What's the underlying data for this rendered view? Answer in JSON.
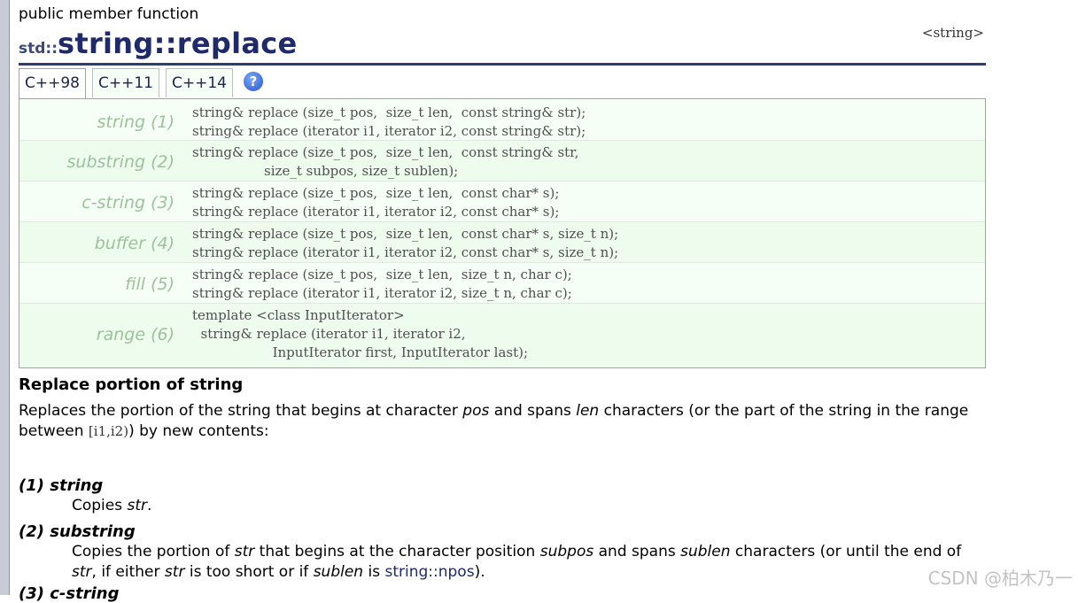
{
  "header": {
    "kind": "public member function",
    "ns": "std::",
    "name": "string::replace",
    "ref": "<string>"
  },
  "tabs": [
    {
      "label": "C++98"
    },
    {
      "label": "C++11"
    },
    {
      "label": "C++14"
    }
  ],
  "help_icon": "?",
  "prototypes": [
    {
      "label": "string (1)",
      "code": "string& replace (size_t pos,  size_t len,  const string& str);\nstring& replace (iterator i1, iterator i2, const string& str);"
    },
    {
      "label": "substring (2)",
      "code": "string& replace (size_t pos,  size_t len,  const string& str,\n                 size_t subpos, size_t sublen);"
    },
    {
      "label": "c-string (3)",
      "code": "string& replace (size_t pos,  size_t len,  const char* s);\nstring& replace (iterator i1, iterator i2, const char* s);"
    },
    {
      "label": "buffer (4)",
      "code": "string& replace (size_t pos,  size_t len,  const char* s, size_t n);\nstring& replace (iterator i1, iterator i2, const char* s, size_t n);"
    },
    {
      "label": "fill (5)",
      "code": "string& replace (size_t pos,  size_t len,  size_t n, char c);\nstring& replace (iterator i1, iterator i2, size_t n, char c);"
    },
    {
      "label": "range (6)",
      "code": "template <class InputIterator>\n  string& replace (iterator i1, iterator i2,\n                   InputIterator first, InputIterator last);"
    }
  ],
  "section_title": "Replace portion of string",
  "para": {
    "t1": "Replaces the portion of the string that begins at character ",
    "pos": "pos",
    "t2": " and spans ",
    "len": "len",
    "t3": " characters (or the part of the string in the range between ",
    "range": "[i1,i2)",
    "t4": ") by new contents:"
  },
  "items": [
    {
      "head": "(1) string",
      "d1": "Copies ",
      "d2": "str",
      "d3": "."
    },
    {
      "head": "(2) substring",
      "d1": "Copies the portion of ",
      "d2": "str",
      "d3": " that begins at the character position ",
      "d4": "subpos",
      "d5": " and spans ",
      "d6": "sublen",
      "d7": " characters (or until the end of ",
      "d8": "str",
      "d9": ", if either ",
      "d10": "str",
      "d11": " is too short or if ",
      "d12": "sublen",
      "d13": " is ",
      "d14": "string::npos",
      "d15": ")."
    },
    {
      "head": "(3) c-string"
    }
  ],
  "watermark": "CSDN @柏木乃一"
}
